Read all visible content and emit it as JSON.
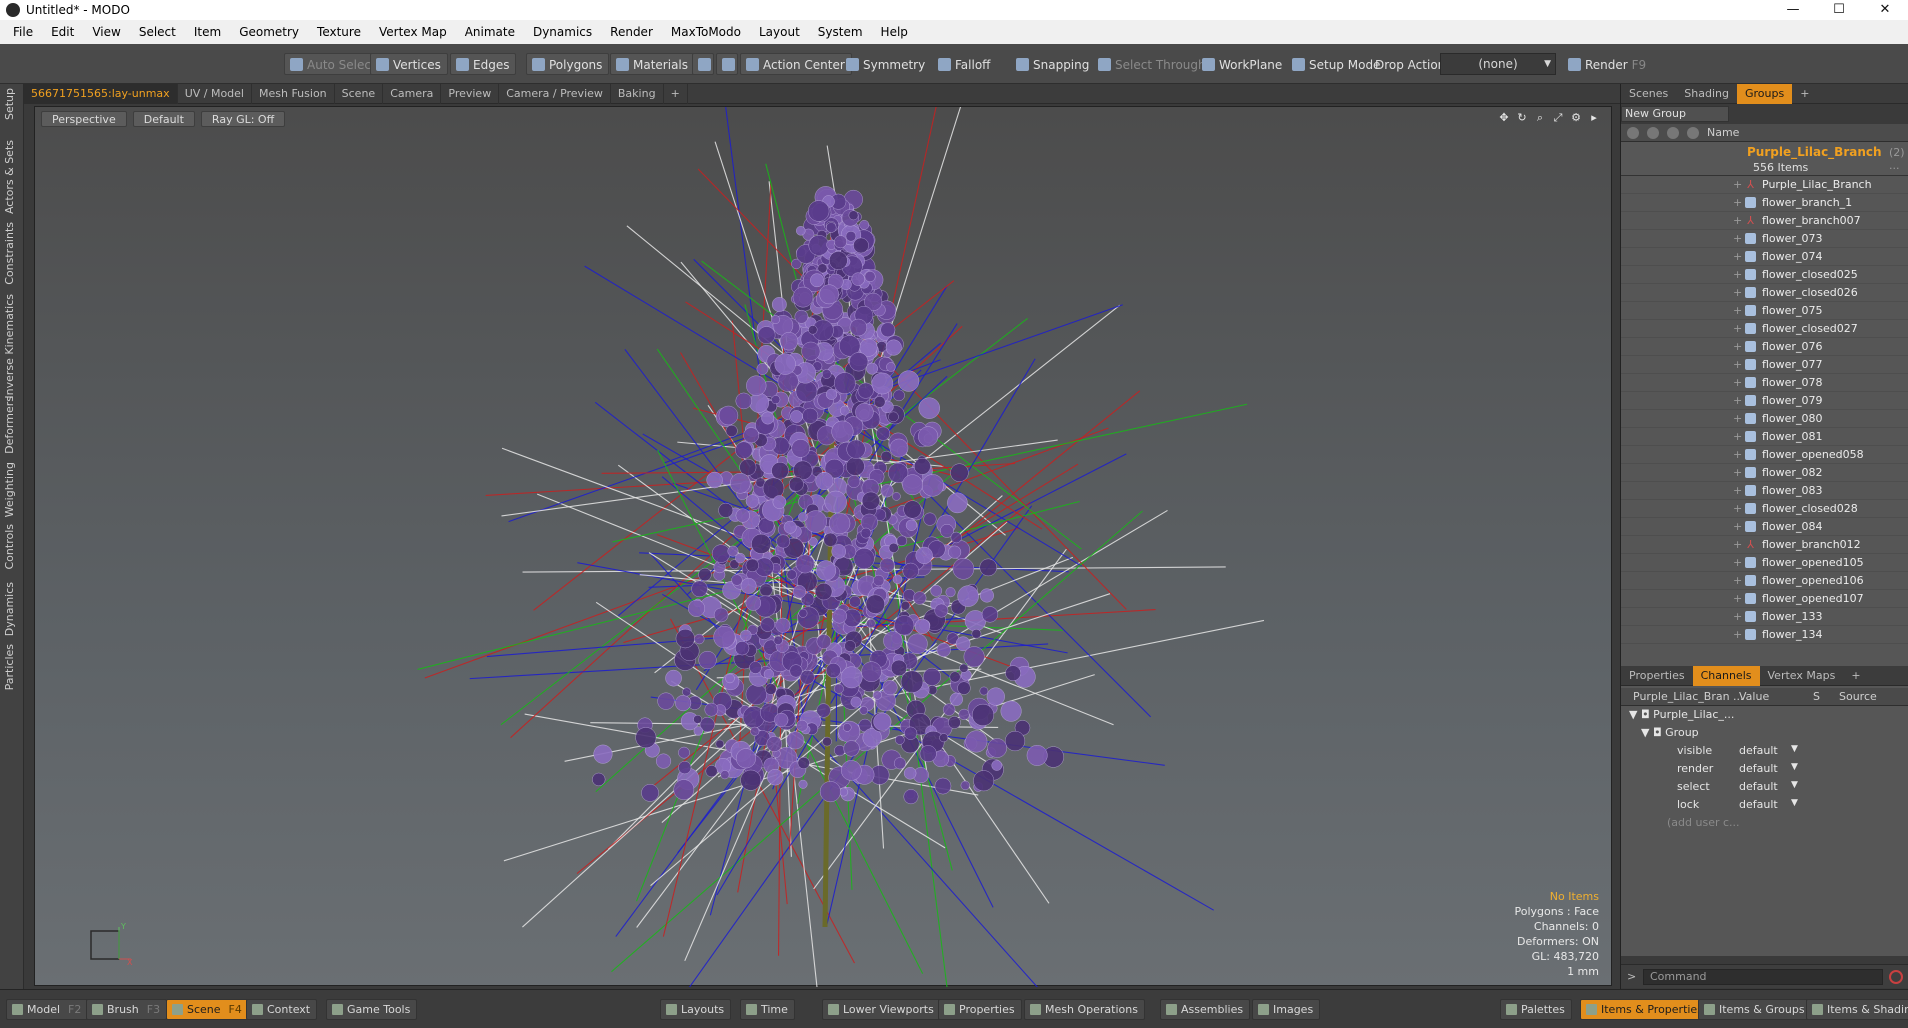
{
  "window": {
    "title": "Untitled* - MODO",
    "min": "—",
    "max": "☐",
    "close": "✕"
  },
  "menu": [
    "File",
    "Edit",
    "View",
    "Select",
    "Item",
    "Geometry",
    "Texture",
    "Vertex Map",
    "Animate",
    "Dynamics",
    "Render",
    "MaxToModo",
    "Layout",
    "System",
    "Help"
  ],
  "toolbar": {
    "auto_select": "Auto Select",
    "vertices": "Vertices",
    "edges": "Edges",
    "polygons": "Polygons",
    "materials": "Materials",
    "action_center": "Action Center",
    "symmetry": "Symmetry",
    "falloff": "Falloff",
    "snapping": "Snapping",
    "select_through": "Select Through",
    "workplane": "WorkPlane",
    "setup_mode": "Setup Mode",
    "drop_action": "Drop Action",
    "drop_value": "(none)",
    "render": "Render",
    "render_key": "F9"
  },
  "left_tabs": [
    "Setup",
    "Actors & Sets",
    "Constraints",
    "Inverse Kinematics",
    "Deformers",
    "Weighting",
    "Controls",
    "Dynamics",
    "Particles"
  ],
  "viewport_tabs": [
    "56671751565:lay-unmax",
    "UV / Model",
    "Mesh Fusion",
    "Scene",
    "Camera",
    "Preview",
    "Camera / Preview",
    "Baking",
    "+"
  ],
  "viewport": {
    "view": "Perspective",
    "shading": "Default",
    "raygl": "Ray GL: Off",
    "info_items": "No Items",
    "info_polygons": "Polygons : Face",
    "info_channels": "Channels: 0",
    "info_deformers": "Deformers: ON",
    "info_gl": "GL: 483,720",
    "info_unit": "1 mm"
  },
  "right_tabs": [
    "Scenes",
    "Shading",
    "Groups",
    "+"
  ],
  "groups": {
    "new_group": "New Group",
    "name_header": "Name",
    "group_name": "Purple_Lilac_Branch",
    "group_num": "(2) ...",
    "group_count": "556 Items",
    "items": [
      {
        "label": "Purple_Lilac_Branch",
        "icon": "locator-icon"
      },
      {
        "label": "flower_branch_1",
        "icon": "mesh-icon"
      },
      {
        "label": "flower_branch007",
        "icon": "locator-icon"
      },
      {
        "label": "flower_073",
        "icon": "mesh-icon"
      },
      {
        "label": "flower_074",
        "icon": "mesh-icon"
      },
      {
        "label": "flower_closed025",
        "icon": "mesh-icon"
      },
      {
        "label": "flower_closed026",
        "icon": "mesh-icon"
      },
      {
        "label": "flower_075",
        "icon": "mesh-icon"
      },
      {
        "label": "flower_closed027",
        "icon": "mesh-icon"
      },
      {
        "label": "flower_076",
        "icon": "mesh-icon"
      },
      {
        "label": "flower_077",
        "icon": "mesh-icon"
      },
      {
        "label": "flower_078",
        "icon": "mesh-icon"
      },
      {
        "label": "flower_079",
        "icon": "mesh-icon"
      },
      {
        "label": "flower_080",
        "icon": "mesh-icon"
      },
      {
        "label": "flower_081",
        "icon": "mesh-icon"
      },
      {
        "label": "flower_opened058",
        "icon": "mesh-icon"
      },
      {
        "label": "flower_082",
        "icon": "mesh-icon"
      },
      {
        "label": "flower_083",
        "icon": "mesh-icon"
      },
      {
        "label": "flower_closed028",
        "icon": "mesh-icon"
      },
      {
        "label": "flower_084",
        "icon": "mesh-icon"
      },
      {
        "label": "flower_branch012",
        "icon": "locator-icon"
      },
      {
        "label": "flower_opened105",
        "icon": "mesh-icon"
      },
      {
        "label": "flower_opened106",
        "icon": "mesh-icon"
      },
      {
        "label": "flower_opened107",
        "icon": "mesh-icon"
      },
      {
        "label": "flower_133",
        "icon": "mesh-icon"
      },
      {
        "label": "flower_134",
        "icon": "mesh-icon"
      }
    ]
  },
  "channel_tabs": [
    "Properties",
    "Channels",
    "Vertex Maps",
    "+"
  ],
  "channels": {
    "col_name": "Purple_Lilac_Bran ...",
    "col_value": "Value",
    "col_s": "S",
    "col_source": "Source",
    "root": "Purple_Lilac_...",
    "group": "Group",
    "rows": [
      {
        "k": "visible",
        "v": "default"
      },
      {
        "k": "render",
        "v": "default"
      },
      {
        "k": "select",
        "v": "default"
      },
      {
        "k": "lock",
        "v": "default"
      }
    ],
    "add_user": "(add user c..."
  },
  "command_placeholder": "Command",
  "statusbar": [
    {
      "label": "Model",
      "key": "F2"
    },
    {
      "label": "Brush",
      "key": "F3"
    },
    {
      "label": "Scene",
      "key": "F4",
      "active": true
    },
    {
      "label": "Context",
      "key": ""
    },
    {
      "label": "Game Tools",
      "key": ""
    },
    {
      "label": "Layouts",
      "key": ""
    },
    {
      "label": "Time",
      "key": ""
    },
    {
      "label": "Lower Viewports",
      "key": ""
    },
    {
      "label": "Properties",
      "key": ""
    },
    {
      "label": "Mesh Operations",
      "key": ""
    },
    {
      "label": "Assemblies",
      "key": ""
    },
    {
      "label": "Images",
      "key": ""
    },
    {
      "label": "Palettes",
      "key": ""
    },
    {
      "label": "Items & Properties",
      "key": "",
      "active": true
    },
    {
      "label": "Items & Groups",
      "key": ""
    },
    {
      "label": "Items & Shading",
      "key": ""
    }
  ],
  "colors": {
    "accent": "#e28e1c",
    "highlight": "#f0a020",
    "flower": "#6b4a9c"
  }
}
